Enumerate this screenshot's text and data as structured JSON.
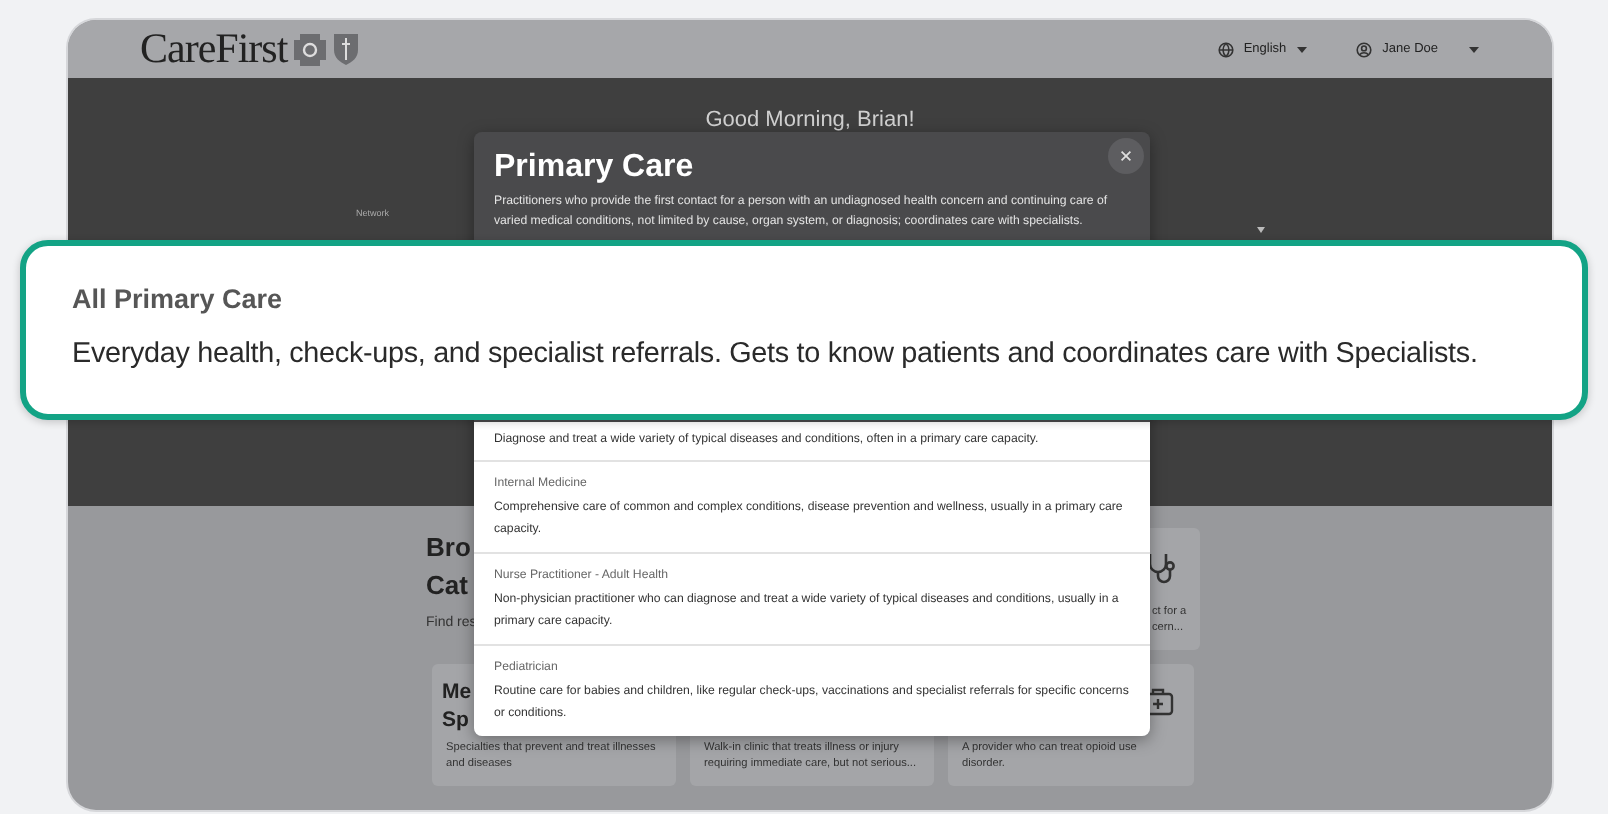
{
  "header": {
    "logo": "CareFirst",
    "language": "English",
    "user": "Jane Doe"
  },
  "greeting": "Good Morning, Brian!",
  "filter": {
    "label": "Network"
  },
  "browse": {
    "title_lines": [
      "Bro",
      "Cat"
    ],
    "subtitle": "Find res"
  },
  "top_card": {
    "kind": "stethoscope",
    "text_lines": [
      "ct for a",
      "cern..."
    ]
  },
  "cards": [
    {
      "kind": "titled",
      "title_lines": [
        "Me",
        "Sp"
      ],
      "description": "Specialties that prevent and treat illnesses and diseases"
    },
    {
      "kind": "plain",
      "description": "Walk-in clinic that treats illness or injury requiring immediate care, but not serious..."
    },
    {
      "kind": "medkit",
      "description": "A provider who can treat opioid use disorder."
    }
  ],
  "modal": {
    "title": "Primary Care",
    "description": "Practitioners who provide the first contact for a person with an undiagnosed health concern and continuing care of varied medical conditions, not limited by cause, organ system, or diagnosis; coordinates care with specialists.",
    "options": [
      {
        "description": "Diagnose and treat a wide variety of typical diseases and conditions, often in a primary care capacity."
      },
      {
        "name": "Internal Medicine",
        "description": "Comprehensive care of common and complex conditions, disease prevention and wellness, usually in a primary care capacity."
      },
      {
        "name": "Nurse Practitioner - Adult Health",
        "description": "Non-physician practitioner who can diagnose and treat a wide variety of typical diseases and conditions, usually in a primary care capacity."
      },
      {
        "name": "Pediatrician",
        "description": "Routine care for babies and children, like regular check-ups, vaccinations and specialist referrals for specific concerns or conditions."
      }
    ]
  },
  "callout": {
    "title": "All Primary Care",
    "description": "Everyday health, check-ups, and specialist referrals. Gets to know patients and coordinates care with Specialists."
  }
}
